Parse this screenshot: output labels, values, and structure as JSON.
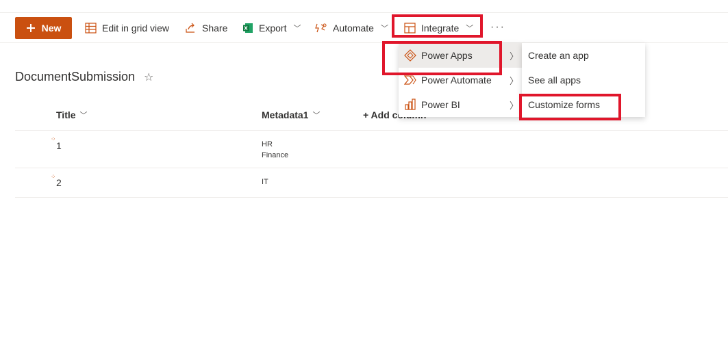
{
  "toolbar": {
    "new_label": "New",
    "edit_grid_label": "Edit in grid view",
    "share_label": "Share",
    "export_label": "Export",
    "automate_label": "Automate",
    "integrate_label": "Integrate",
    "more_label": "···"
  },
  "list": {
    "title": "DocumentSubmission",
    "columns": {
      "title": "Title",
      "metadata": "Metadata1",
      "add_column": "+ Add column"
    },
    "rows": [
      {
        "title": "1",
        "metadata": [
          "HR",
          "Finance"
        ]
      },
      {
        "title": "2",
        "metadata": [
          "IT"
        ]
      }
    ]
  },
  "integrate_menu": {
    "items": [
      {
        "label": "Power Apps",
        "icon": "power-apps-icon"
      },
      {
        "label": "Power Automate",
        "icon": "power-automate-icon"
      },
      {
        "label": "Power BI",
        "icon": "power-bi-icon"
      }
    ]
  },
  "power_apps_submenu": {
    "items": [
      "Create an app",
      "See all apps",
      "Customize forms"
    ]
  },
  "colors": {
    "accent": "#ca5010",
    "highlight": "#e0162b",
    "excel": "#107c41"
  }
}
